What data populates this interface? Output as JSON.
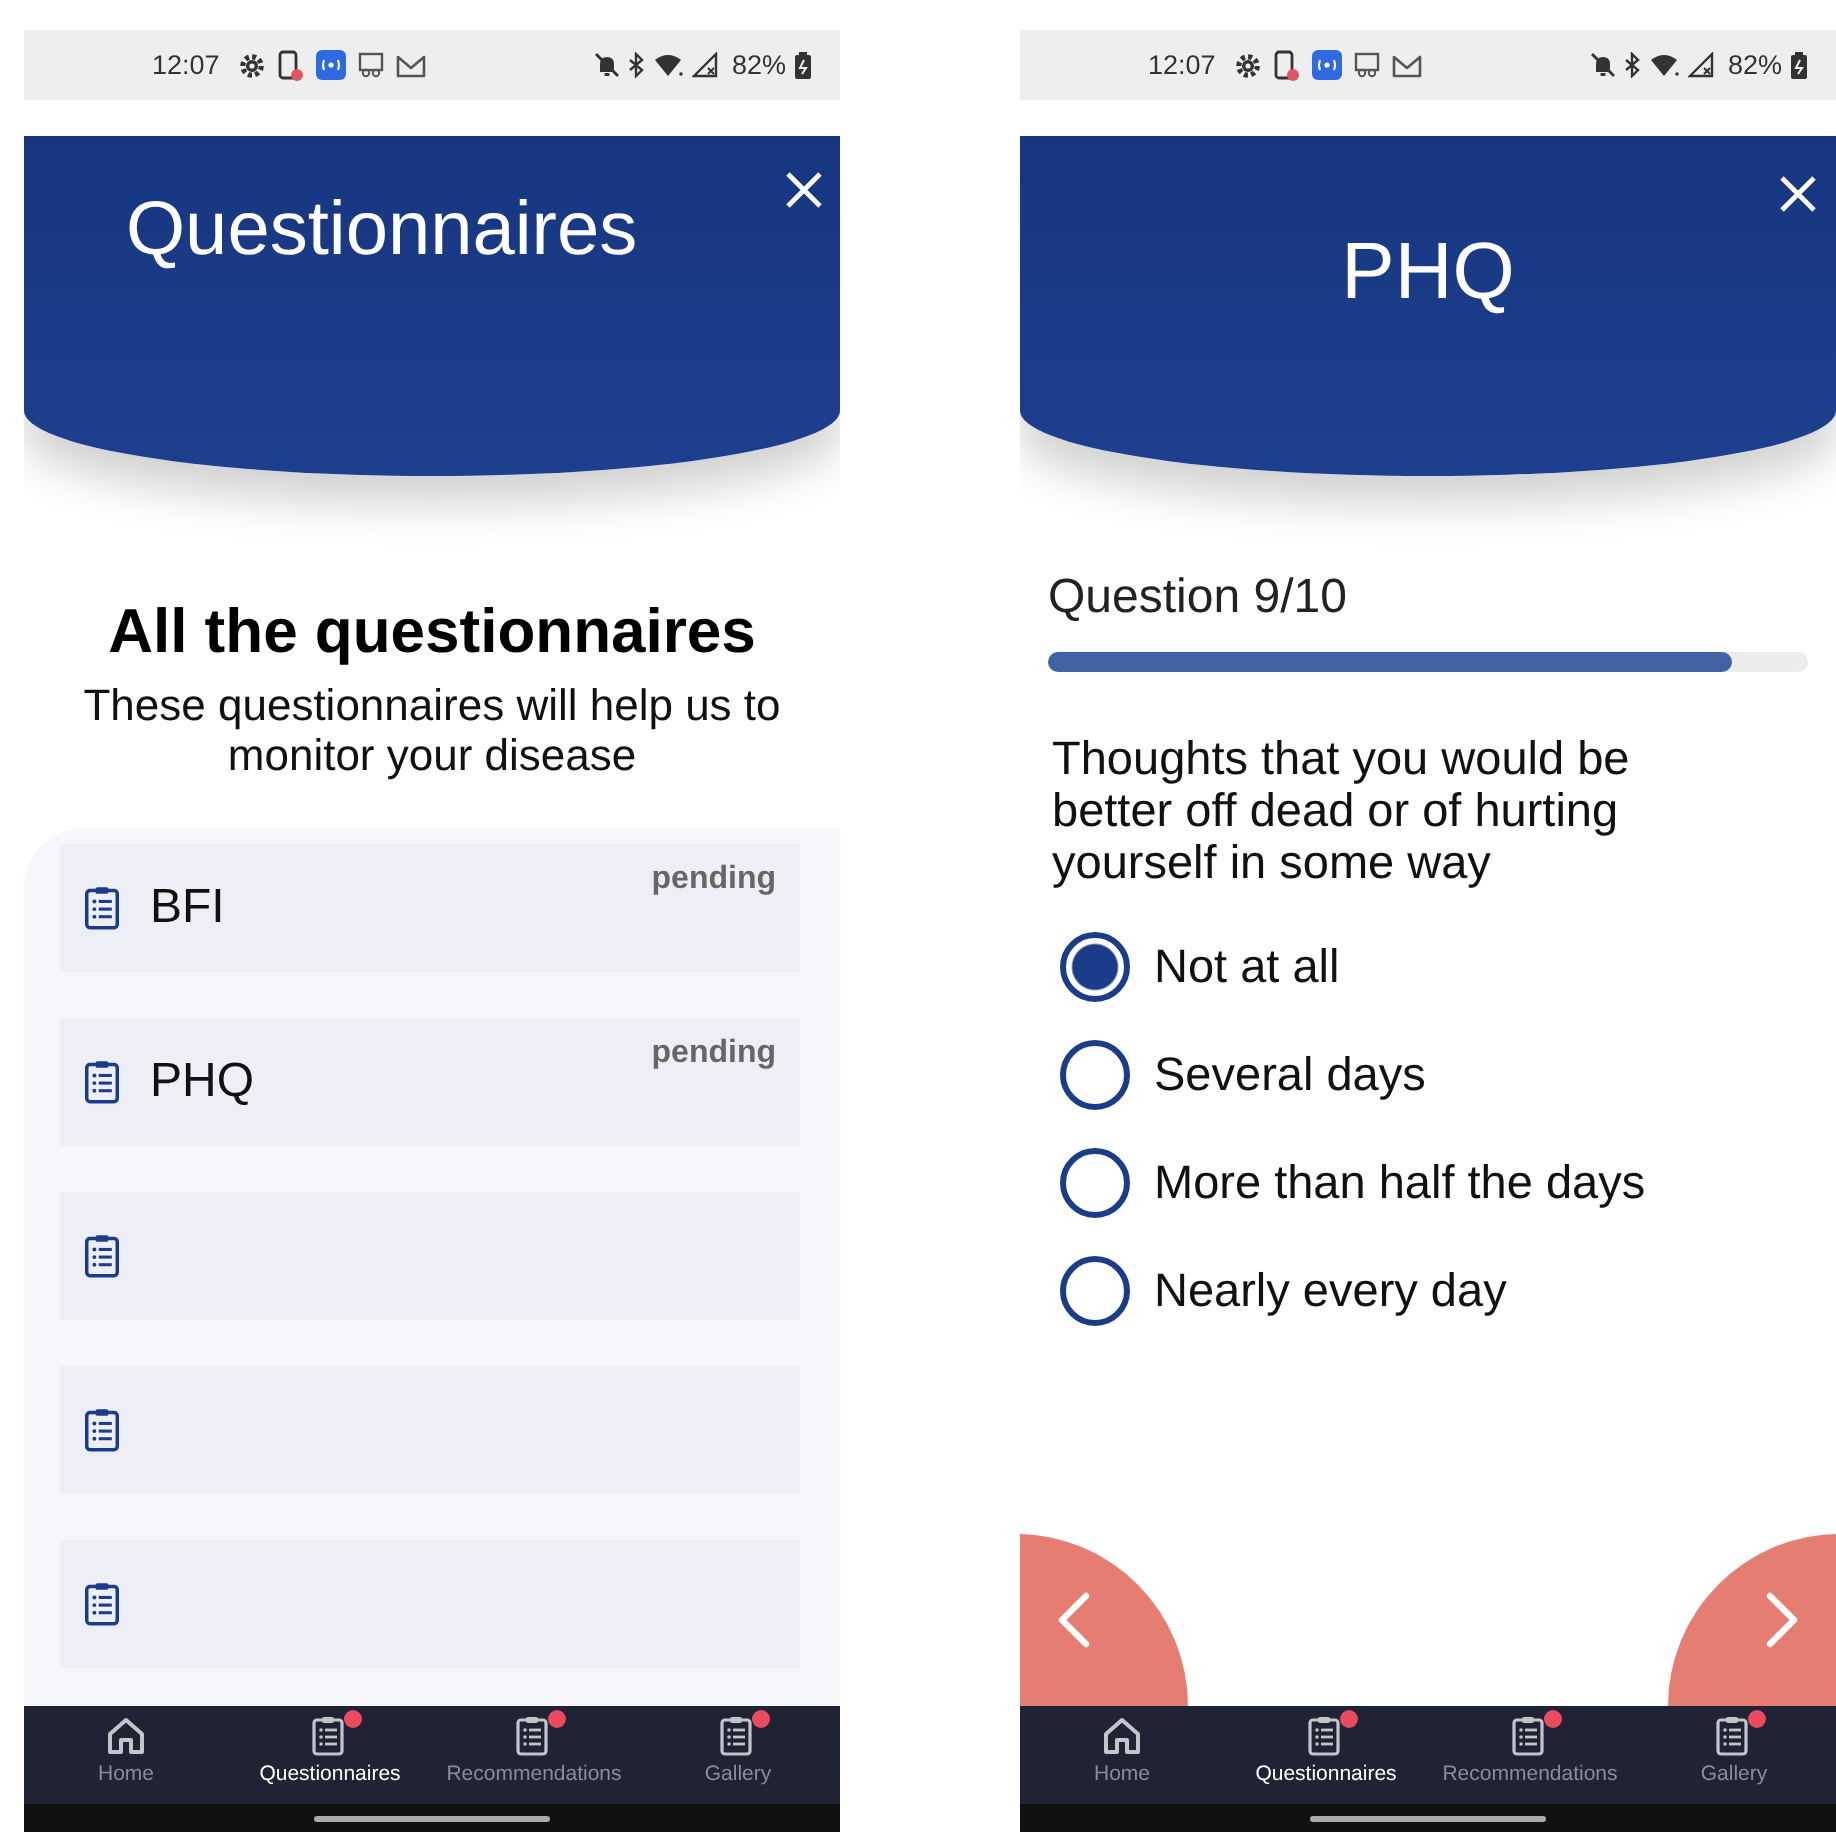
{
  "screens": [
    {
      "kind": "list",
      "status_bar": {
        "time": "12:07",
        "battery": "82%"
      },
      "header": {
        "title": "Questionnaires"
      },
      "heading": "All the questionnaires",
      "subtitle": "These questionnaires will help us  to monitor your disease",
      "questionnaires": [
        {
          "kind": "filled",
          "name": "BFI",
          "status": "pending"
        },
        {
          "kind": "filled",
          "name": "PHQ",
          "status": "pending"
        },
        {
          "kind": "blank"
        },
        {
          "kind": "blank"
        },
        {
          "kind": "blank"
        }
      ],
      "nav": [
        {
          "kind": "home",
          "label": "Home",
          "selected": false,
          "badge": false
        },
        {
          "kind": "page",
          "label": "Questionnaires",
          "selected": true,
          "badge": true
        },
        {
          "kind": "page",
          "label": "Recommendations",
          "selected": false,
          "badge": true
        },
        {
          "kind": "page",
          "label": "Gallery",
          "selected": false,
          "badge": true
        }
      ]
    },
    {
      "kind": "question",
      "status_bar": {
        "time": "12:07",
        "battery": "82%"
      },
      "header": {
        "title": "PHQ"
      },
      "progress": {
        "label": "Question 9/10",
        "level": 0.9
      },
      "question": "Thoughts that you would be better off dead or of hurting yourself in some way",
      "options": [
        {
          "label": "Not at all",
          "selected": true
        },
        {
          "label": "Several days",
          "selected": false
        },
        {
          "label": "More than half the days",
          "selected": false
        },
        {
          "label": "Nearly every day",
          "selected": false
        }
      ],
      "nav": [
        {
          "kind": "home",
          "label": "Home",
          "selected": false,
          "badge": false
        },
        {
          "kind": "page",
          "label": "Questionnaires",
          "selected": true,
          "badge": true
        },
        {
          "kind": "page",
          "label": "Recommendations",
          "selected": false,
          "badge": true
        },
        {
          "kind": "page",
          "label": "Gallery",
          "selected": false,
          "badge": true
        }
      ]
    }
  ]
}
